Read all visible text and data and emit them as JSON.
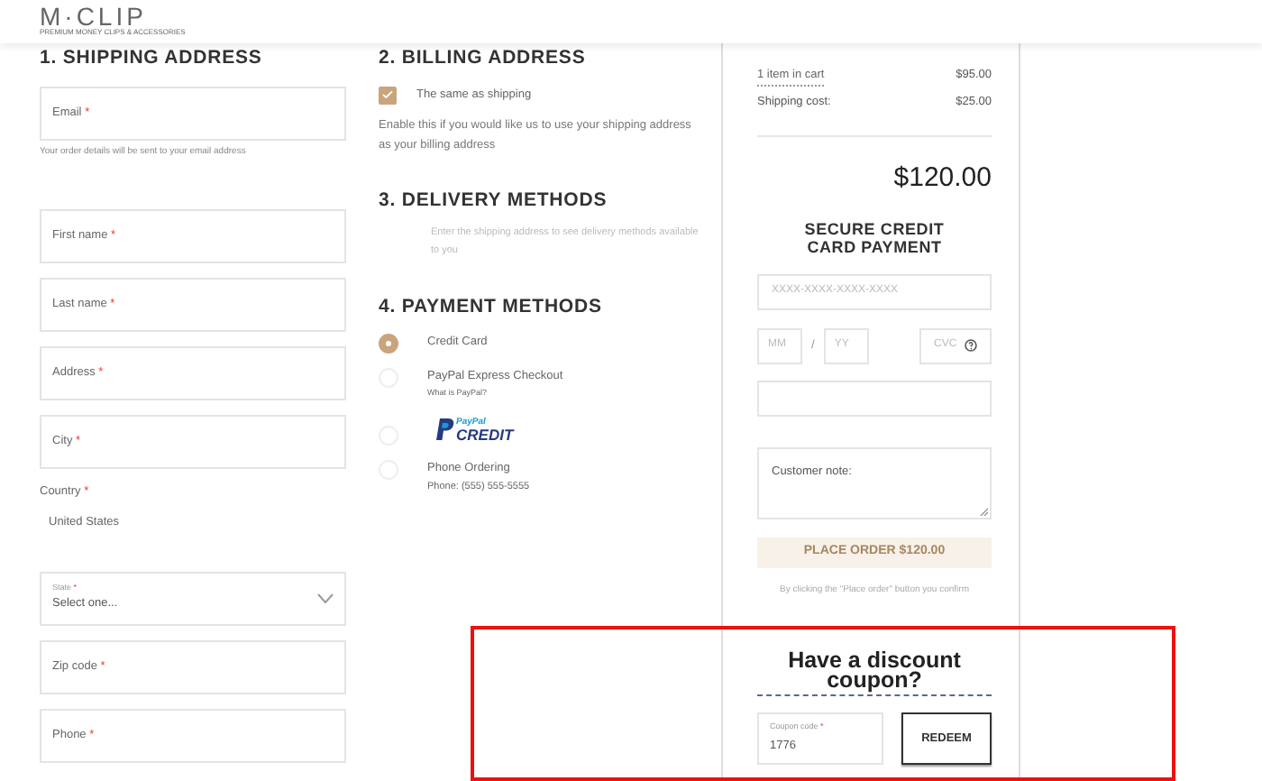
{
  "logo": {
    "name": "M·CLIP",
    "tagline": "PREMIUM MONEY CLIPS & ACCESSORIES"
  },
  "shipping": {
    "title": "1.  SHIPPING ADDRESS",
    "fields": [
      {
        "kind": "text",
        "label": "Email",
        "mark": "*",
        "hint": "Your order details will be sent to your email address"
      },
      {
        "kind": "text",
        "label": "First name",
        "mark": "*"
      },
      {
        "kind": "text",
        "label": "Last name",
        "mark": "*"
      },
      {
        "kind": "text",
        "label": "Address",
        "mark": "*"
      },
      {
        "kind": "text",
        "label": "City",
        "mark": "*"
      },
      {
        "kind": "static",
        "label": "Country",
        "mark": "*",
        "value": "United States"
      },
      {
        "kind": "select",
        "label": "State",
        "mark": "*",
        "value": "Select one..."
      },
      {
        "kind": "text",
        "label": "Zip code",
        "mark": "*"
      },
      {
        "kind": "text",
        "label": "Phone",
        "mark": "*"
      }
    ]
  },
  "billing": {
    "title": "2.  BILLING ADDRESS",
    "same_label": "The same as shipping",
    "checked": true,
    "help": "Enable this if you would like us to use your shipping address as your billing address"
  },
  "delivery": {
    "title": "3.  DELIVERY METHODS",
    "note": "Enter the shipping address to see delivery methods available to you"
  },
  "payment": {
    "title": "4.  PAYMENT METHODS",
    "methods": [
      {
        "kind": "text",
        "label": "Credit Card",
        "selected": true
      },
      {
        "kind": "text",
        "label": "PayPal Express Checkout",
        "sub": "What is PayPal?",
        "selected": false
      },
      {
        "kind": "logo",
        "logo_top": "PayPal",
        "logo_bottom": "CREDIT",
        "selected": false
      },
      {
        "kind": "text",
        "label": "Phone Ordering",
        "sub": "Phone: (555) 555-5555",
        "selected": false
      }
    ]
  },
  "summary": {
    "items_link": "1 item in cart",
    "items_price": "$95.00",
    "shipping_label": "Shipping cost:",
    "shipping_price": "$25.00",
    "total": "$120.00",
    "card_title": "SECURE CREDIT CARD PAYMENT",
    "card_placeholder": "XXXX-XXXX-XXXX-XXXX",
    "month_placeholder": "MM",
    "separator": "/",
    "year_placeholder": "YY",
    "cvc_placeholder": "CVC",
    "note_placeholder": "Customer note:",
    "place_order": "PLACE ORDER  $120.00",
    "place_order_disabled": true,
    "terms": "By clicking the \"Place order\" button you confirm"
  },
  "coupon": {
    "title": "Have a discount coupon?",
    "label": "Coupon code",
    "mark": "*",
    "value": "1776",
    "button": "REDEEM"
  }
}
